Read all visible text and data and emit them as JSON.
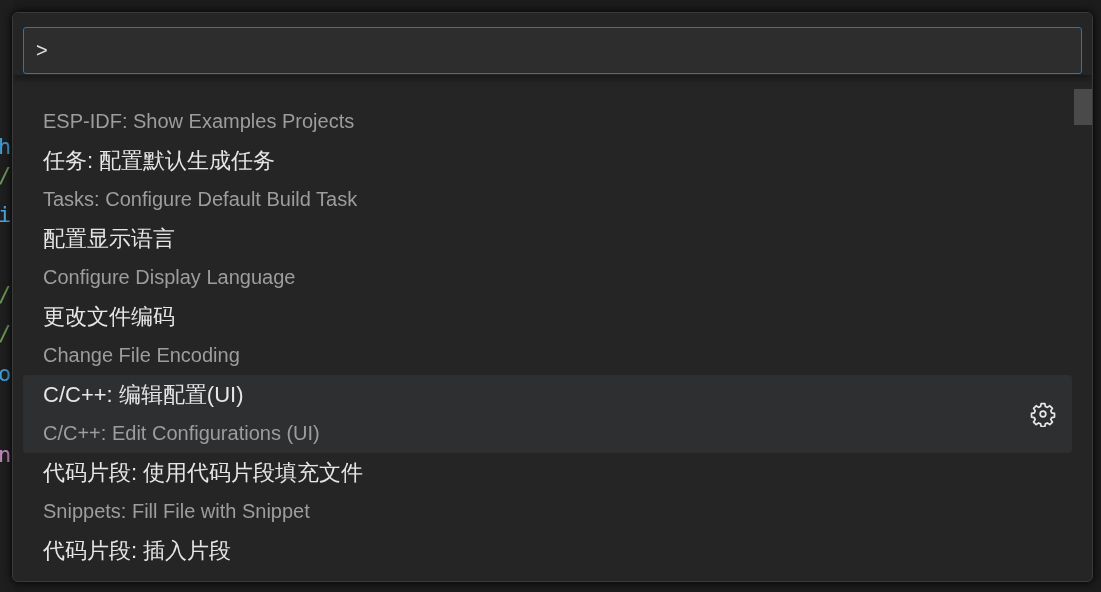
{
  "editor_fragments": [
    {
      "text": "h",
      "color": "#3f9cd6"
    },
    {
      "text": "/",
      "color": "#6a9955"
    },
    {
      "text": "i",
      "color": "#4fa3e0"
    },
    {
      "text": "/",
      "color": "#6a9955"
    },
    {
      "text": "/",
      "color": "#6a9955"
    },
    {
      "text": "o",
      "color": "#3f9cd6"
    },
    {
      "text": "n",
      "color": "#c586c0"
    }
  ],
  "command_input": {
    "value": ">"
  },
  "items": [
    {
      "detail": "ESP-IDF: Show Examples Projects",
      "selected": false
    },
    {
      "label": "任务: 配置默认生成任务",
      "detail": "Tasks: Configure Default Build Task",
      "selected": false
    },
    {
      "label": "配置显示语言",
      "detail": "Configure Display Language",
      "selected": false
    },
    {
      "label": "更改文件编码",
      "detail": "Change File Encoding",
      "selected": false
    },
    {
      "label": "C/C++: 编辑配置(UI)",
      "detail": "C/C++: Edit Configurations (UI)",
      "selected": true
    },
    {
      "label": "代码片段: 使用代码片段填充文件",
      "detail": "Snippets: Fill File with Snippet",
      "selected": false
    },
    {
      "label": "代码片段: 插入片段",
      "selected": false
    }
  ]
}
